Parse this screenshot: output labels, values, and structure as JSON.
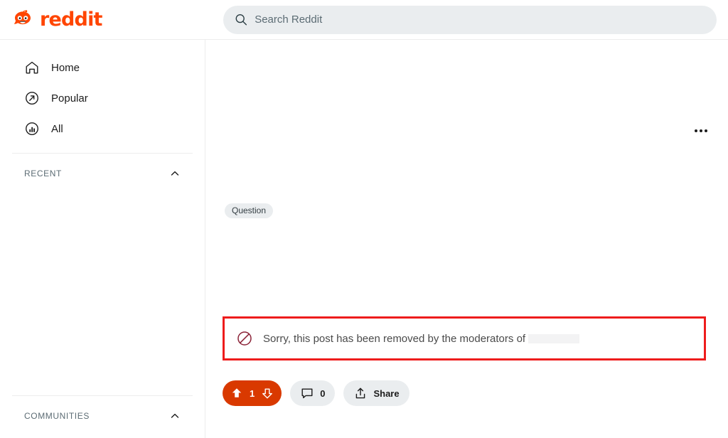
{
  "header": {
    "brand": "reddit",
    "logo_icon": "reddit-snoo-icon",
    "brand_color": "#ff4500",
    "search": {
      "icon": "search-icon",
      "placeholder": "Search Reddit",
      "value": ""
    }
  },
  "sidebar": {
    "nav": [
      {
        "label": "Home",
        "icon": "home-icon"
      },
      {
        "label": "Popular",
        "icon": "popular-arrow-icon"
      },
      {
        "label": "All",
        "icon": "all-bars-icon"
      }
    ],
    "sections": [
      {
        "title": "RECENT",
        "toggle_icon": "chevron-up-icon"
      },
      {
        "title": "COMMUNITIES",
        "toggle_icon": "chevron-up-icon"
      }
    ]
  },
  "post": {
    "overflow_icon": "overflow-menu-icon",
    "flair": "Question",
    "removal": {
      "icon": "prohibited-icon",
      "message": "Sorry, this post has been removed by the moderators of",
      "subreddit_redacted": true,
      "highlight_color": "#ee1c1c"
    },
    "actions": {
      "vote": {
        "upvote_icon": "upvote-arrow-icon",
        "downvote_icon": "downvote-arrow-icon",
        "count": "1",
        "state_color": "#d93900"
      },
      "comments": {
        "icon": "comment-bubble-icon",
        "count": "0"
      },
      "share": {
        "icon": "share-icon",
        "label": "Share"
      }
    }
  }
}
